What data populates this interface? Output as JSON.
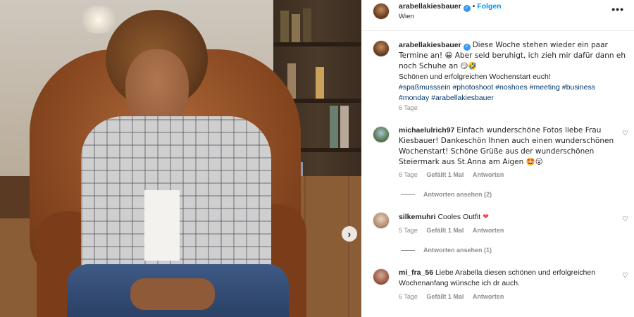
{
  "post": {
    "author": "arabellakiesbauer",
    "location": "Wien",
    "follow_label": "Folgen",
    "dot": "•",
    "more_label": "•••",
    "next_label": "›"
  },
  "caption": {
    "author": "arabellakiesbauer",
    "text": "Diese Woche stehen wieder ein paar Termine an! 😀 Aber seid beruhigt, ich zieh mir dafür dann eh noch Schuhe an 😏🤣",
    "line2": "Schönen und erfolgreichen Wochenstart euch!",
    "hashtags": "#spaßmusssein #photoshoot #noshoes #meeting #business #monday #arabellakiesbauer",
    "time": "6 Tage"
  },
  "comments": [
    {
      "user": "michaelulrich97",
      "text": "Einfach wunderschöne Fotos liebe Frau Kiesbauer! Dankeschön Ihnen auch einen wunderschönen Wochenstart! Schöne Grüße aus der wunderschönen Steiermark aus St.Anna am Aigen 🤩😮",
      "time": "6 Tage",
      "likes": "Gefällt 1 Mal",
      "reply": "Antworten",
      "view_replies": "Antworten ansehen (2)"
    },
    {
      "user": "silkemuhri",
      "text": "Cooles Outfit",
      "heart": "❤",
      "time": "5 Tage",
      "likes": "Gefällt 1 Mal",
      "reply": "Antworten",
      "view_replies": "Antworten ansehen (1)"
    },
    {
      "user": "mi_fra_56",
      "text": "Liebe Arabella diesen schönen und erfolgreichen Wochenanfang wünsche ich dr auch.",
      "time": "6 Tage",
      "likes": "Gefällt 1 Mal",
      "reply": "Antworten"
    }
  ],
  "icons": {
    "verified": "✓",
    "like": "♡"
  },
  "colors": {
    "link": "#0095f6",
    "hashtag": "#00376b",
    "muted": "#8e8e8e",
    "verified": "#3897f0"
  }
}
